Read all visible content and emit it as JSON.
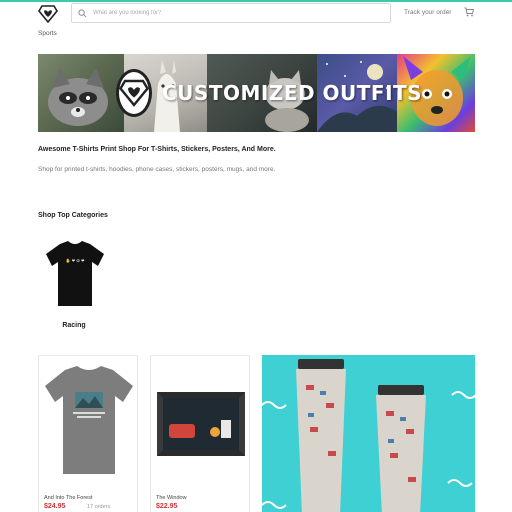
{
  "colors": {
    "accent": "#3cc9a8",
    "price": "#d0343a",
    "promo_bg": "#3fd0d4"
  },
  "header": {
    "logo_icon": "diamond-heart-logo-icon",
    "search_placeholder": "What are you looking for?",
    "search_icon": "search-icon",
    "track_order_label": "Track your order",
    "cart_icon": "cart-icon"
  },
  "nav": {
    "sports_label": "Sports"
  },
  "banner": {
    "title": "CUSTOMIZED OUTFITS",
    "badge_icon": "diamond-heart-logo-icon"
  },
  "intro": {
    "title": "Awesome T-Shirts Print Shop For T-Shirts, Stickers, Posters, And More.",
    "subtitle": "Shop for printed t-shirts, hoodies, phone cases, stickers, posters, mugs, and more."
  },
  "categories": {
    "heading": "Shop Top Categories",
    "items": [
      {
        "label": "Racing"
      }
    ]
  },
  "products": [
    {
      "title": "And Into The Forest",
      "price": "$24.95",
      "orders": "17 orders"
    },
    {
      "title": "The Window",
      "price": "$22.95"
    },
    {
      "title": ""
    }
  ]
}
